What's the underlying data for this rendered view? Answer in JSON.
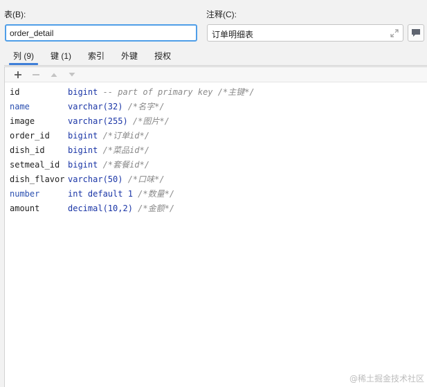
{
  "labels": {
    "table": "表(B):",
    "comment": "注释(C):"
  },
  "table_name": "order_detail",
  "table_comment": "订单明细表",
  "tabs": [
    {
      "label": "列 (9)",
      "active": true
    },
    {
      "label": "键 (1)",
      "active": false
    },
    {
      "label": "索引",
      "active": false
    },
    {
      "label": "外键",
      "active": false
    },
    {
      "label": "授权",
      "active": false
    }
  ],
  "toolbar": {
    "add": {
      "icon": "plus-icon",
      "label": "+"
    },
    "remove": {
      "icon": "minus-icon",
      "label": "−"
    },
    "move_up": {
      "icon": "arrow-up-icon",
      "label": "▲"
    },
    "move_down": {
      "icon": "arrow-down-icon",
      "label": "▼"
    }
  },
  "columns": [
    {
      "name": "id",
      "type": "bigint",
      "comment": " -- part of primary key /*主键*/",
      "blue": false
    },
    {
      "name": "name",
      "type": "varchar(32)",
      "comment": " /*名字*/",
      "blue": true
    },
    {
      "name": "image",
      "type": "varchar(255)",
      "comment": " /*图片*/",
      "blue": false
    },
    {
      "name": "order_id",
      "type": "bigint",
      "comment": " /*订单id*/",
      "blue": false
    },
    {
      "name": "dish_id",
      "type": "bigint",
      "comment": " /*菜品id*/",
      "blue": false
    },
    {
      "name": "setmeal_id",
      "type": "bigint",
      "comment": " /*套餐id*/",
      "blue": false
    },
    {
      "name": "dish_flavor",
      "type": "varchar(50)",
      "comment": " /*口味*/",
      "blue": false
    },
    {
      "name": "number",
      "type": "int default 1",
      "comment": " /*数量*/",
      "blue": true
    },
    {
      "name": "amount",
      "type": "decimal(10,2)",
      "comment": " /*金额*/",
      "blue": false
    }
  ],
  "watermark": "@稀土掘金技术社区",
  "colors": {
    "accent": "#4f9ee8",
    "tab_underline": "#3f7fd8",
    "type_blue": "#1a35a6",
    "comment_gray": "#8a8a8a"
  }
}
